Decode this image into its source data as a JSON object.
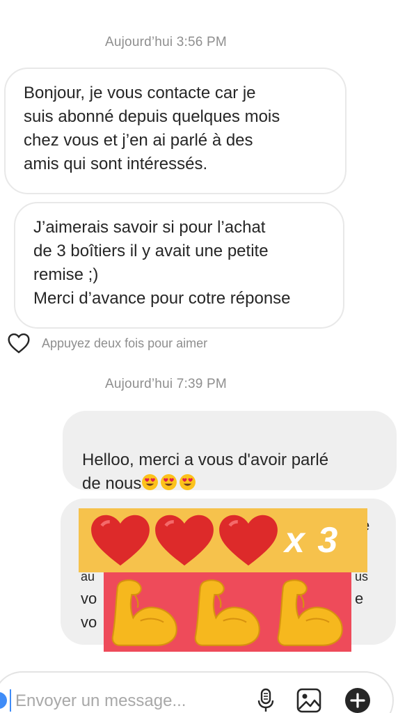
{
  "thread": {
    "timestamp_1": "Aujourd’hui 3:56 PM",
    "timestamp_2": "Aujourd’hui 7:39 PM",
    "incoming_1": "Bonjour, je vous contacte car je\nsuis abonné depuis quelques mois\nchez vous et j’en ai parlé à des\namis qui sont intéressés.",
    "incoming_2": "J’aimerais savoir si pour l’achat\nde 3 boîtiers il y avait une petite\nremise ;)\nMerci d’avance pour cotre réponse",
    "like_hint": "Appuyez deux fois pour aimer",
    "outgoing_1": "Helloo, merci a vous d'avoir parlé\nde nous",
    "outgoing_1_emojis": [
      "heart-eyes-emoji",
      "heart-eyes-emoji",
      "heart-eyes-emoji"
    ],
    "outgoing_2_fragments": [
      "e",
      "au",
      "us",
      "vo",
      "e",
      "vo"
    ]
  },
  "stickers": {
    "hearts_multiplier": "x 3",
    "hearts": [
      "red-heart-icon",
      "red-heart-icon",
      "red-heart-icon"
    ],
    "muscles": [
      "flexed-biceps-icon",
      "flexed-biceps-icon",
      "flexed-biceps-icon"
    ],
    "hearts_bg": "#f6c24c",
    "muscles_bg": "#ee4b5a"
  },
  "composer": {
    "placeholder": "Envoyer un message...",
    "mic": "microphone-icon",
    "gallery": "image-gallery-icon",
    "more": "plus-circle-icon"
  }
}
